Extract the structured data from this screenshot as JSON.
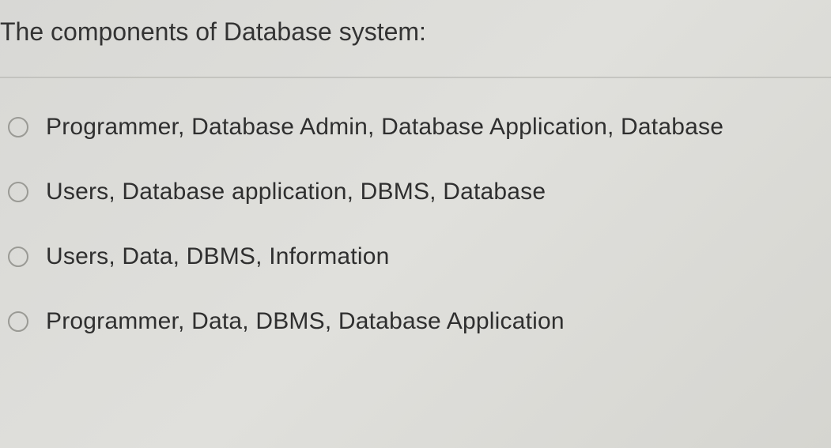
{
  "question": {
    "text": "The components of Database system:"
  },
  "options": [
    {
      "label": "Programmer, Database Admin, Database Application, Database"
    },
    {
      "label": "Users, Database application, DBMS, Database"
    },
    {
      "label": "Users, Data, DBMS, Information"
    },
    {
      "label": "Programmer, Data, DBMS, Database Application"
    }
  ]
}
